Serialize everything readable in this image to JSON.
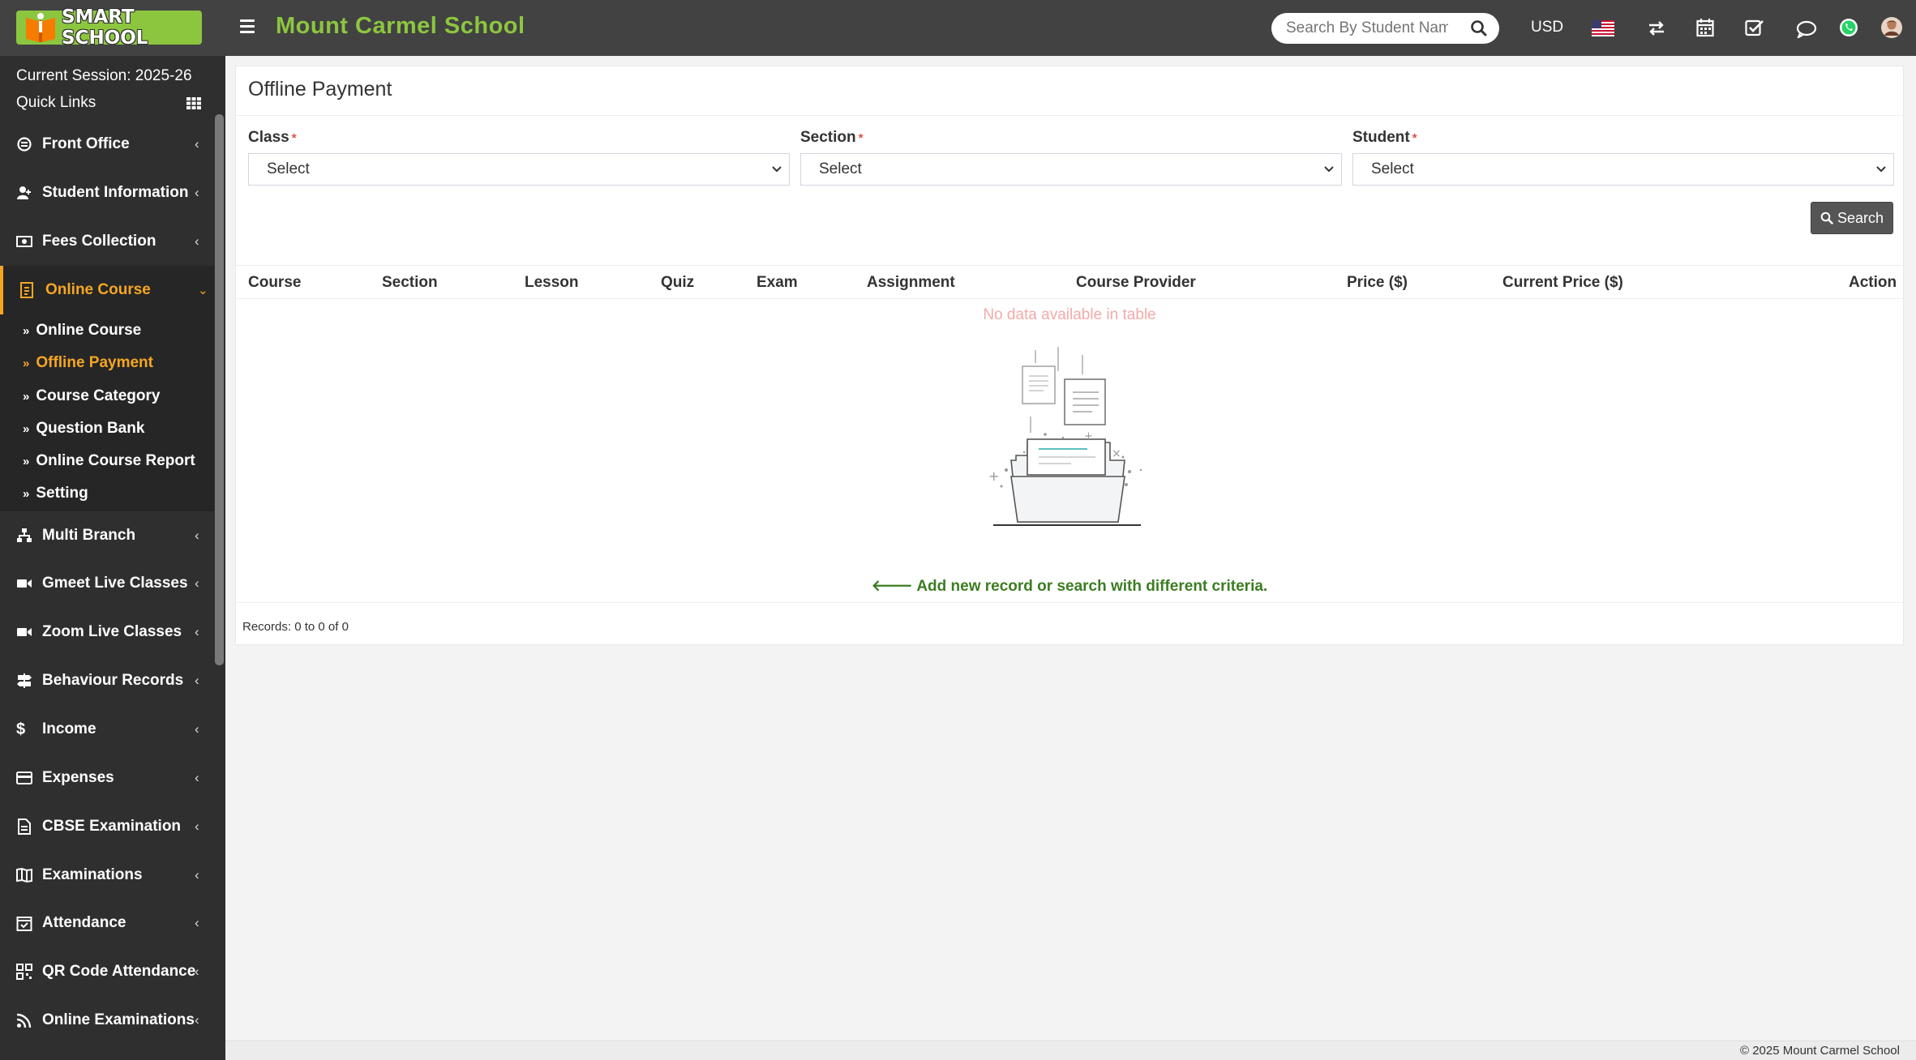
{
  "header": {
    "logo_text": "SMART SCHOOL",
    "school_name": "Mount Carmel School",
    "search_placeholder": "Search By Student Name",
    "currency": "USD"
  },
  "sidebar": {
    "session": "Current Session: 2025-26",
    "quick_links": "Quick Links",
    "items": [
      {
        "label": "Front Office",
        "icon": "front-office-icon"
      },
      {
        "label": "Student Information",
        "icon": "user-plus-icon"
      },
      {
        "label": "Fees Collection",
        "icon": "money-icon"
      },
      {
        "label": "Online Course",
        "icon": "online-course-icon"
      },
      {
        "label": "Multi Branch",
        "icon": "sitemap-icon"
      },
      {
        "label": "Gmeet Live Classes",
        "icon": "video-icon"
      },
      {
        "label": "Zoom Live Classes",
        "icon": "video-icon"
      },
      {
        "label": "Behaviour Records",
        "icon": "signpost-icon"
      },
      {
        "label": "Income",
        "icon": "dollar-icon"
      },
      {
        "label": "Expenses",
        "icon": "credit-card-icon"
      },
      {
        "label": "CBSE Examination",
        "icon": "file-icon"
      },
      {
        "label": "Examinations",
        "icon": "book-open-icon"
      },
      {
        "label": "Attendance",
        "icon": "calendar-check-icon"
      },
      {
        "label": "QR Code Attendance",
        "icon": "qrcode-icon"
      },
      {
        "label": "Online Examinations",
        "icon": "rss-icon"
      }
    ],
    "submenu": [
      {
        "label": "Online Course"
      },
      {
        "label": "Offline Payment"
      },
      {
        "label": "Course Category"
      },
      {
        "label": "Question Bank"
      },
      {
        "label": "Online Course Report"
      },
      {
        "label": "Setting"
      }
    ]
  },
  "main": {
    "title": "Offline Payment",
    "filters": {
      "class_label": "Class",
      "section_label": "Section",
      "student_label": "Student",
      "required_mark": "*",
      "class_value": "Select",
      "section_value": "Select",
      "student_value": "Select"
    },
    "search_button": "Search",
    "table": {
      "columns": [
        "Course",
        "Section",
        "Lesson",
        "Quiz",
        "Exam",
        "Assignment",
        "Course Provider",
        "Price ($)",
        "Current Price ($)",
        "Action"
      ],
      "empty_text": "No data available in table",
      "add_record_text": "Add new record or search with different criteria.",
      "records_text": "Records: 0 to 0 of 0"
    }
  },
  "footer": {
    "copyright": "© 2025 Mount Carmel School"
  },
  "colors": {
    "accent_green": "#8cc63f",
    "active_orange": "#f5a623",
    "header_bg": "#424242",
    "sidebar_bg": "#2f2f2f"
  }
}
